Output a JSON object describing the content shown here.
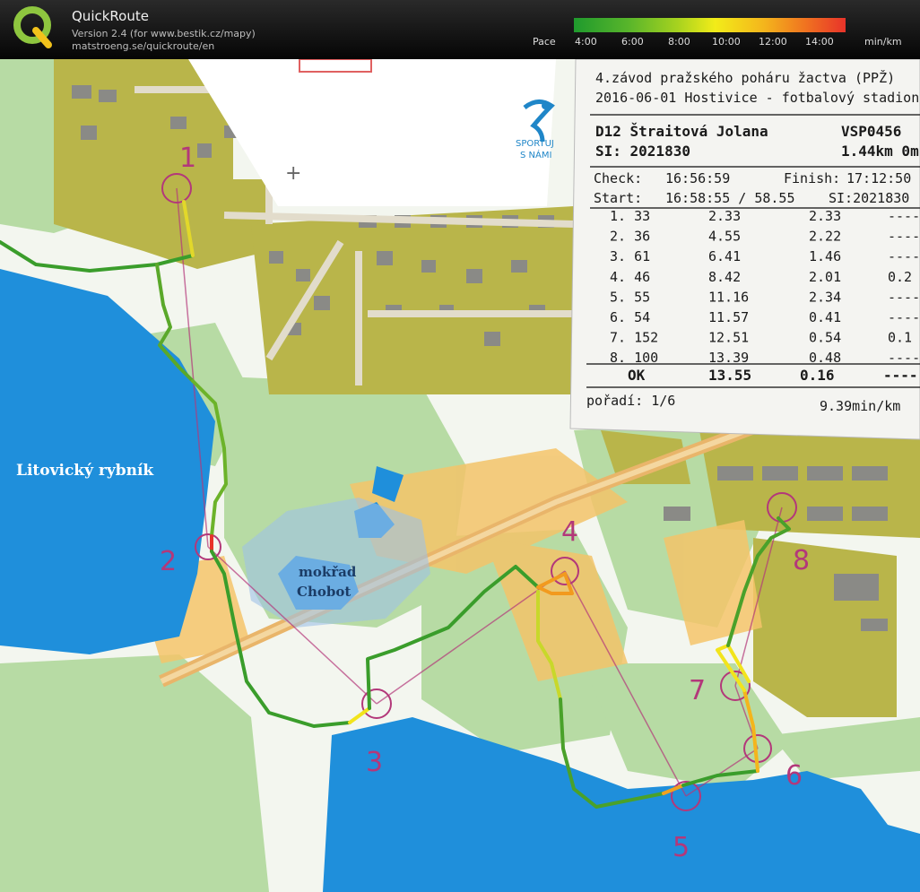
{
  "app": {
    "title": "QuickRoute",
    "version_line": "Version 2.4  (for www.bestik.cz/mapy)",
    "website": "matstroeng.se/quickroute/en"
  },
  "pace_scale": {
    "label": "Pace",
    "ticks": [
      "4:00",
      "6:00",
      "8:00",
      "10:00",
      "12:00",
      "14:00"
    ],
    "unit": "min/km"
  },
  "map_labels": {
    "lake_name": "Litovický rybník",
    "wetland_line1": "mokřad",
    "wetland_line2": "Chobot",
    "sport_logo_line1": "SPORTUJ",
    "sport_logo_line2": "S NÁMI"
  },
  "controls": [
    "1",
    "2",
    "3",
    "4",
    "5",
    "6",
    "7",
    "8"
  ],
  "receipt": {
    "event_line1": "4.závod pražského poháru žactva (PPŽ)",
    "event_line2": "2016-06-01 Hostivice - fotbalový stadion",
    "category_name": "D12 Štraitová Jolana",
    "club": "VSP0456",
    "si": "SI: 2021830",
    "course": "1.44km 0m",
    "check_label": "Check:",
    "check_time": "16:56:59",
    "finish_label": "Finish:",
    "finish_time": "17:12:50",
    "start_label": "Start:",
    "start_time": "16:58:55 / 58.55",
    "start_si": "SI:2021830",
    "splits": [
      {
        "code": "1. 33",
        "total": "2.33",
        "split": "2.33",
        "extra": "----"
      },
      {
        "code": "2. 36",
        "total": "4.55",
        "split": "2.22",
        "extra": "----"
      },
      {
        "code": "3. 61",
        "total": "6.41",
        "split": "1.46",
        "extra": "----"
      },
      {
        "code": "4. 46",
        "total": "8.42",
        "split": "2.01",
        "extra": "0.2"
      },
      {
        "code": "5. 55",
        "total": "11.16",
        "split": "2.34",
        "extra": "----"
      },
      {
        "code": "6. 54",
        "total": "11.57",
        "split": "0.41",
        "extra": "----"
      },
      {
        "code": "7. 152",
        "total": "12.51",
        "split": "0.54",
        "extra": "0.1"
      },
      {
        "code": "8. 100",
        "total": "13.39",
        "split": "0.48",
        "extra": "----"
      }
    ],
    "ok_label": "OK",
    "ok_total": "13.55",
    "ok_split": "0.16",
    "ok_extra": "----",
    "rank": "pořadí: 1/6",
    "pace": "9.39min/km"
  },
  "colors": {
    "route_fast": "#2f9a2a",
    "route_mid": "#b8d42a",
    "route_slow": "#f29a1e",
    "route_stop": "#e8332a",
    "control_purple": "#b3387a"
  }
}
